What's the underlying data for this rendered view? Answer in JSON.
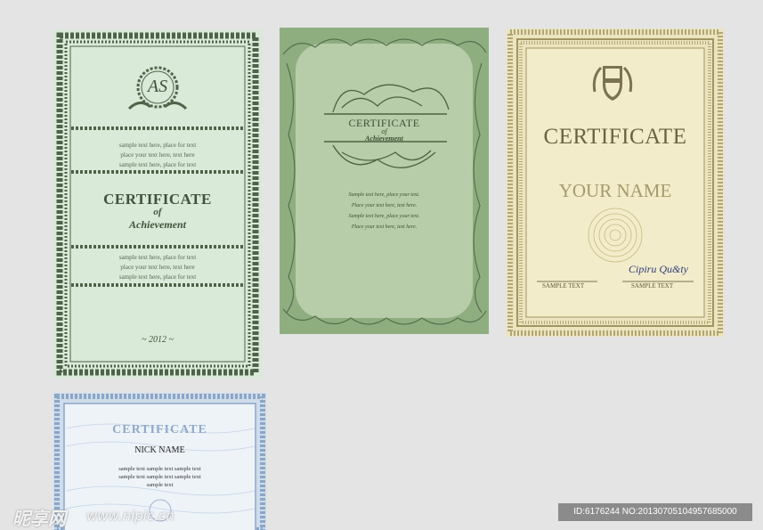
{
  "cert1": {
    "monogram": "AS",
    "sample_top": [
      "sample text here, place for text",
      "place your text here,  text here",
      "sample text here, place for text"
    ],
    "title": "CERTIFICATE",
    "of": "of",
    "achievement": "Achievement",
    "sample_bottom": [
      "sample text here, place for text",
      "place your text here,  text here",
      "sample text here, place for text"
    ],
    "year": "~ 2012 ~"
  },
  "cert2": {
    "title": "CERTIFICATE",
    "of": "of",
    "achievement": "Achievement",
    "lines": [
      "Sample text here, place your text.",
      "Place your text here, text here.",
      "Sample text here, place your text.",
      "Place your text here, text here."
    ]
  },
  "cert3": {
    "title": "CERTIFICATE",
    "name": "YOUR NAME",
    "sample_left": "SAMPLE  TEXT",
    "sample_right": "SAMPLE  TEXT",
    "signature": "Cipiru Qu&ty"
  },
  "cert4": {
    "title": "CERTIFICATE",
    "name": "NICK NAME",
    "lines": [
      "sample text sample text sample text",
      "sample text sample text sample text",
      "sample text"
    ]
  },
  "watermark": {
    "logo": "昵享网",
    "url": "www.nipic.cn",
    "id_text": "ID:6176244 NO:20130705104957685000"
  },
  "colors": {
    "green_dark": "#4a5e44",
    "olive": "#6d6640",
    "blue": "#6f8fb5"
  }
}
